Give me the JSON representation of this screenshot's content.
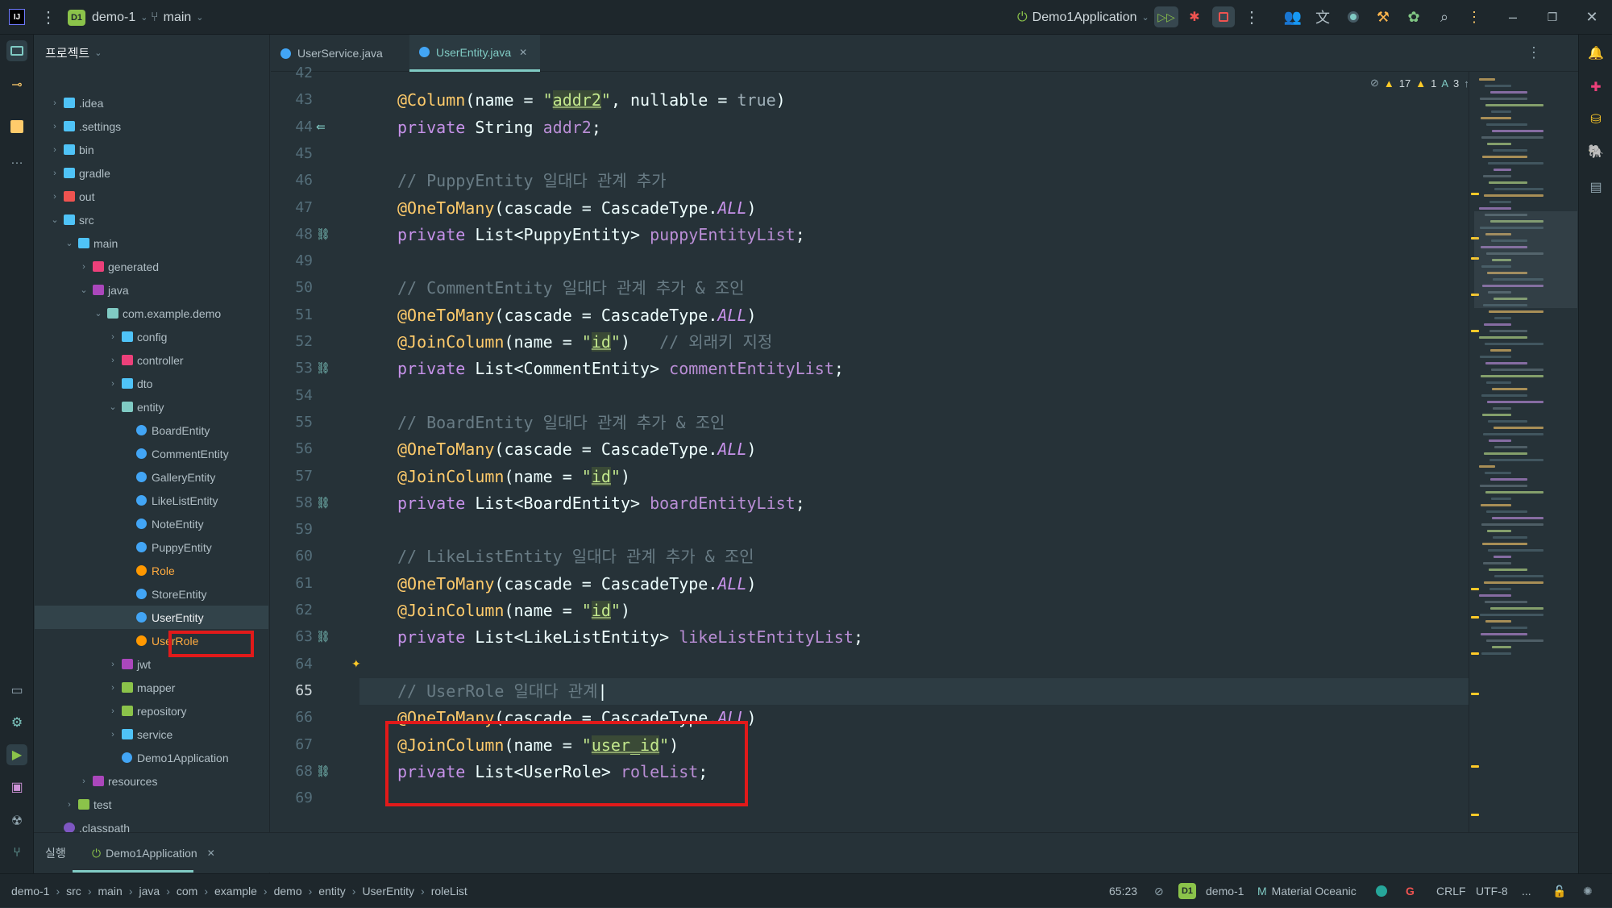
{
  "titlebar": {
    "project_badge": "D1",
    "project_name": "demo-1",
    "branch": "main",
    "run_config": "Demo1Application"
  },
  "project_panel": {
    "title": "프로젝트",
    "items": [
      {
        "label": ".idea",
        "depth": 1,
        "type": "folder",
        "chevron": "closed"
      },
      {
        "label": ".settings",
        "depth": 1,
        "type": "folder",
        "chevron": "closed"
      },
      {
        "label": "bin",
        "depth": 1,
        "type": "folder",
        "chevron": "closed"
      },
      {
        "label": "gradle",
        "depth": 1,
        "type": "folder",
        "chevron": "closed"
      },
      {
        "label": "out",
        "depth": 1,
        "type": "folder-red",
        "chevron": "closed"
      },
      {
        "label": "src",
        "depth": 1,
        "type": "folder",
        "chevron": "open"
      },
      {
        "label": "main",
        "depth": 2,
        "type": "folder",
        "chevron": "open"
      },
      {
        "label": "generated",
        "depth": 3,
        "type": "folder-pink",
        "chevron": "closed"
      },
      {
        "label": "java",
        "depth": 3,
        "type": "folder-purple",
        "chevron": "open"
      },
      {
        "label": "com.example.demo",
        "depth": 4,
        "type": "package",
        "chevron": "open"
      },
      {
        "label": "config",
        "depth": 5,
        "type": "folder",
        "chevron": "closed"
      },
      {
        "label": "controller",
        "depth": 5,
        "type": "folder-pink",
        "chevron": "closed"
      },
      {
        "label": "dto",
        "depth": 5,
        "type": "folder",
        "chevron": "closed"
      },
      {
        "label": "entity",
        "depth": 5,
        "type": "package",
        "chevron": "open"
      },
      {
        "label": "BoardEntity",
        "depth": 6,
        "type": "class",
        "chevron": "none"
      },
      {
        "label": "CommentEntity",
        "depth": 6,
        "type": "class",
        "chevron": "none"
      },
      {
        "label": "GalleryEntity",
        "depth": 6,
        "type": "class",
        "chevron": "none"
      },
      {
        "label": "LikeListEntity",
        "depth": 6,
        "type": "class",
        "chevron": "none"
      },
      {
        "label": "NoteEntity",
        "depth": 6,
        "type": "class",
        "chevron": "none"
      },
      {
        "label": "PuppyEntity",
        "depth": 6,
        "type": "class",
        "chevron": "none"
      },
      {
        "label": "Role",
        "depth": 6,
        "type": "class-orange",
        "chevron": "none"
      },
      {
        "label": "StoreEntity",
        "depth": 6,
        "type": "class",
        "chevron": "none"
      },
      {
        "label": "UserEntity",
        "depth": 6,
        "type": "class",
        "chevron": "none",
        "selected": true
      },
      {
        "label": "UserRole",
        "depth": 6,
        "type": "class-orange",
        "chevron": "none"
      },
      {
        "label": "jwt",
        "depth": 5,
        "type": "folder-purple",
        "chevron": "closed"
      },
      {
        "label": "mapper",
        "depth": 5,
        "type": "folder-green",
        "chevron": "closed"
      },
      {
        "label": "repository",
        "depth": 5,
        "type": "folder-green",
        "chevron": "closed"
      },
      {
        "label": "service",
        "depth": 5,
        "type": "folder",
        "chevron": "closed"
      },
      {
        "label": "Demo1Application",
        "depth": 5,
        "type": "class-app",
        "chevron": "none"
      },
      {
        "label": "resources",
        "depth": 3,
        "type": "folder-purple",
        "chevron": "closed"
      },
      {
        "label": "test",
        "depth": 2,
        "type": "folder-green",
        "chevron": "closed"
      },
      {
        "label": ".classpath",
        "depth": 1,
        "type": "file",
        "chevron": "none"
      }
    ]
  },
  "tabs": [
    {
      "label": "UserService.java",
      "active": false
    },
    {
      "label": "UserEntity.java",
      "active": true
    }
  ],
  "inspections": {
    "warnings": "17",
    "weak_warnings": "1",
    "typos": "3"
  },
  "editor": {
    "current_line": 65,
    "lines": [
      {
        "n": "42",
        "tokens": []
      },
      {
        "n": "43",
        "tokens": [
          {
            "t": "@Column",
            "c": "ann"
          },
          {
            "t": "(name = ",
            "c": "plain"
          },
          {
            "t": "\"",
            "c": "str"
          },
          {
            "t": "addr2",
            "c": "strhl"
          },
          {
            "t": "\"",
            "c": "str"
          },
          {
            "t": ", nullable = ",
            "c": "plain"
          },
          {
            "t": "true",
            "c": "bool"
          },
          {
            "t": ")",
            "c": "plain"
          }
        ]
      },
      {
        "n": "44",
        "icon": "⇚",
        "tokens": [
          {
            "t": "private ",
            "c": "kw"
          },
          {
            "t": "String ",
            "c": "plain"
          },
          {
            "t": "addr2",
            "c": "field"
          },
          {
            "t": ";",
            "c": "plain"
          }
        ]
      },
      {
        "n": "45",
        "tokens": []
      },
      {
        "n": "46",
        "tokens": [
          {
            "t": "// PuppyEntity 일대다 관계 추가",
            "c": "comment"
          }
        ]
      },
      {
        "n": "47",
        "tokens": [
          {
            "t": "@OneToMany",
            "c": "ann"
          },
          {
            "t": "(cascade = CascadeType.",
            "c": "plain"
          },
          {
            "t": "ALL",
            "c": "const"
          },
          {
            "t": ")",
            "c": "plain"
          }
        ]
      },
      {
        "n": "48",
        "icon": "🔗",
        "tokens": [
          {
            "t": "private ",
            "c": "kw"
          },
          {
            "t": "List<PuppyEntity> ",
            "c": "plain"
          },
          {
            "t": "puppyEntityList",
            "c": "field"
          },
          {
            "t": ";",
            "c": "plain"
          }
        ]
      },
      {
        "n": "49",
        "tokens": []
      },
      {
        "n": "50",
        "tokens": [
          {
            "t": "// CommentEntity 일대다 관계 추가 & 조인",
            "c": "comment"
          }
        ]
      },
      {
        "n": "51",
        "tokens": [
          {
            "t": "@OneToMany",
            "c": "ann"
          },
          {
            "t": "(cascade = CascadeType.",
            "c": "plain"
          },
          {
            "t": "ALL",
            "c": "const"
          },
          {
            "t": ")",
            "c": "plain"
          }
        ]
      },
      {
        "n": "52",
        "tokens": [
          {
            "t": "@JoinColumn",
            "c": "ann"
          },
          {
            "t": "(name = ",
            "c": "plain"
          },
          {
            "t": "\"",
            "c": "str"
          },
          {
            "t": "id",
            "c": "strhl"
          },
          {
            "t": "\"",
            "c": "str"
          },
          {
            "t": ")   ",
            "c": "plain"
          },
          {
            "t": "// 외래키 지정",
            "c": "comment"
          }
        ]
      },
      {
        "n": "53",
        "icon": "🔗",
        "tokens": [
          {
            "t": "private ",
            "c": "kw"
          },
          {
            "t": "List<CommentEntity> ",
            "c": "plain"
          },
          {
            "t": "commentEntityList",
            "c": "field"
          },
          {
            "t": ";",
            "c": "plain"
          }
        ]
      },
      {
        "n": "54",
        "tokens": []
      },
      {
        "n": "55",
        "tokens": [
          {
            "t": "// BoardEntity 일대다 관계 추가 & 조인",
            "c": "comment"
          }
        ]
      },
      {
        "n": "56",
        "tokens": [
          {
            "t": "@OneToMany",
            "c": "ann"
          },
          {
            "t": "(cascade = CascadeType.",
            "c": "plain"
          },
          {
            "t": "ALL",
            "c": "const"
          },
          {
            "t": ")",
            "c": "plain"
          }
        ]
      },
      {
        "n": "57",
        "tokens": [
          {
            "t": "@JoinColumn",
            "c": "ann"
          },
          {
            "t": "(name = ",
            "c": "plain"
          },
          {
            "t": "\"",
            "c": "str"
          },
          {
            "t": "id",
            "c": "strhl"
          },
          {
            "t": "\"",
            "c": "str"
          },
          {
            "t": ")",
            "c": "plain"
          }
        ]
      },
      {
        "n": "58",
        "icon": "🔗",
        "tokens": [
          {
            "t": "private ",
            "c": "kw"
          },
          {
            "t": "List<BoardEntity> ",
            "c": "plain"
          },
          {
            "t": "boardEntityList",
            "c": "field"
          },
          {
            "t": ";",
            "c": "plain"
          }
        ]
      },
      {
        "n": "59",
        "tokens": []
      },
      {
        "n": "60",
        "tokens": [
          {
            "t": "// LikeListEntity 일대다 관계 추가 & 조인",
            "c": "comment"
          }
        ]
      },
      {
        "n": "61",
        "tokens": [
          {
            "t": "@OneToMany",
            "c": "ann"
          },
          {
            "t": "(cascade = CascadeType.",
            "c": "plain"
          },
          {
            "t": "ALL",
            "c": "const"
          },
          {
            "t": ")",
            "c": "plain"
          }
        ]
      },
      {
        "n": "62",
        "tokens": [
          {
            "t": "@JoinColumn",
            "c": "ann"
          },
          {
            "t": "(name = ",
            "c": "plain"
          },
          {
            "t": "\"",
            "c": "str"
          },
          {
            "t": "id",
            "c": "strhl"
          },
          {
            "t": "\"",
            "c": "str"
          },
          {
            "t": ")",
            "c": "plain"
          }
        ]
      },
      {
        "n": "63",
        "icon": "🔗",
        "tokens": [
          {
            "t": "private ",
            "c": "kw"
          },
          {
            "t": "List<LikeListEntity> ",
            "c": "plain"
          },
          {
            "t": "likeListEntityList",
            "c": "field"
          },
          {
            "t": ";",
            "c": "plain"
          }
        ]
      },
      {
        "n": "64",
        "icon2": "💡",
        "tokens": []
      },
      {
        "n": "65",
        "tokens": [
          {
            "t": "// UserRole 일대다 관계",
            "c": "comment"
          },
          {
            "t": "|",
            "c": "plain"
          }
        ]
      },
      {
        "n": "66",
        "tokens": [
          {
            "t": "@OneToMany",
            "c": "ann"
          },
          {
            "t": "(cascade = CascadeType.",
            "c": "plain"
          },
          {
            "t": "ALL",
            "c": "const"
          },
          {
            "t": ")",
            "c": "plain"
          }
        ]
      },
      {
        "n": "67",
        "tokens": [
          {
            "t": "@JoinColumn",
            "c": "ann"
          },
          {
            "t": "(name = ",
            "c": "plain"
          },
          {
            "t": "\"",
            "c": "str"
          },
          {
            "t": "user_id",
            "c": "strhl"
          },
          {
            "t": "\"",
            "c": "str"
          },
          {
            "t": ")",
            "c": "plain"
          }
        ]
      },
      {
        "n": "68",
        "icon": "🔗",
        "tokens": [
          {
            "t": "private ",
            "c": "kw"
          },
          {
            "t": "List<UserRole> ",
            "c": "plain"
          },
          {
            "t": "roleList",
            "c": "field"
          },
          {
            "t": ";",
            "c": "plain"
          }
        ]
      },
      {
        "n": "69",
        "tokens": []
      }
    ]
  },
  "bottom_panel": {
    "run_label": "실행",
    "run_tab": "Demo1Application"
  },
  "breadcrumbs": [
    "demo-1",
    "src",
    "main",
    "java",
    "com",
    "example",
    "demo",
    "entity",
    "UserEntity",
    "roleList"
  ],
  "status": {
    "position": "65:23",
    "project_badge": "D1",
    "project": "demo-1",
    "theme": "Material Oceanic",
    "line_sep": "CRLF",
    "encoding": "UTF-8",
    "more": "..."
  },
  "colors": {
    "accent": "#80cbc4",
    "highlight_box": "#e11a1a",
    "background": "#263238"
  }
}
